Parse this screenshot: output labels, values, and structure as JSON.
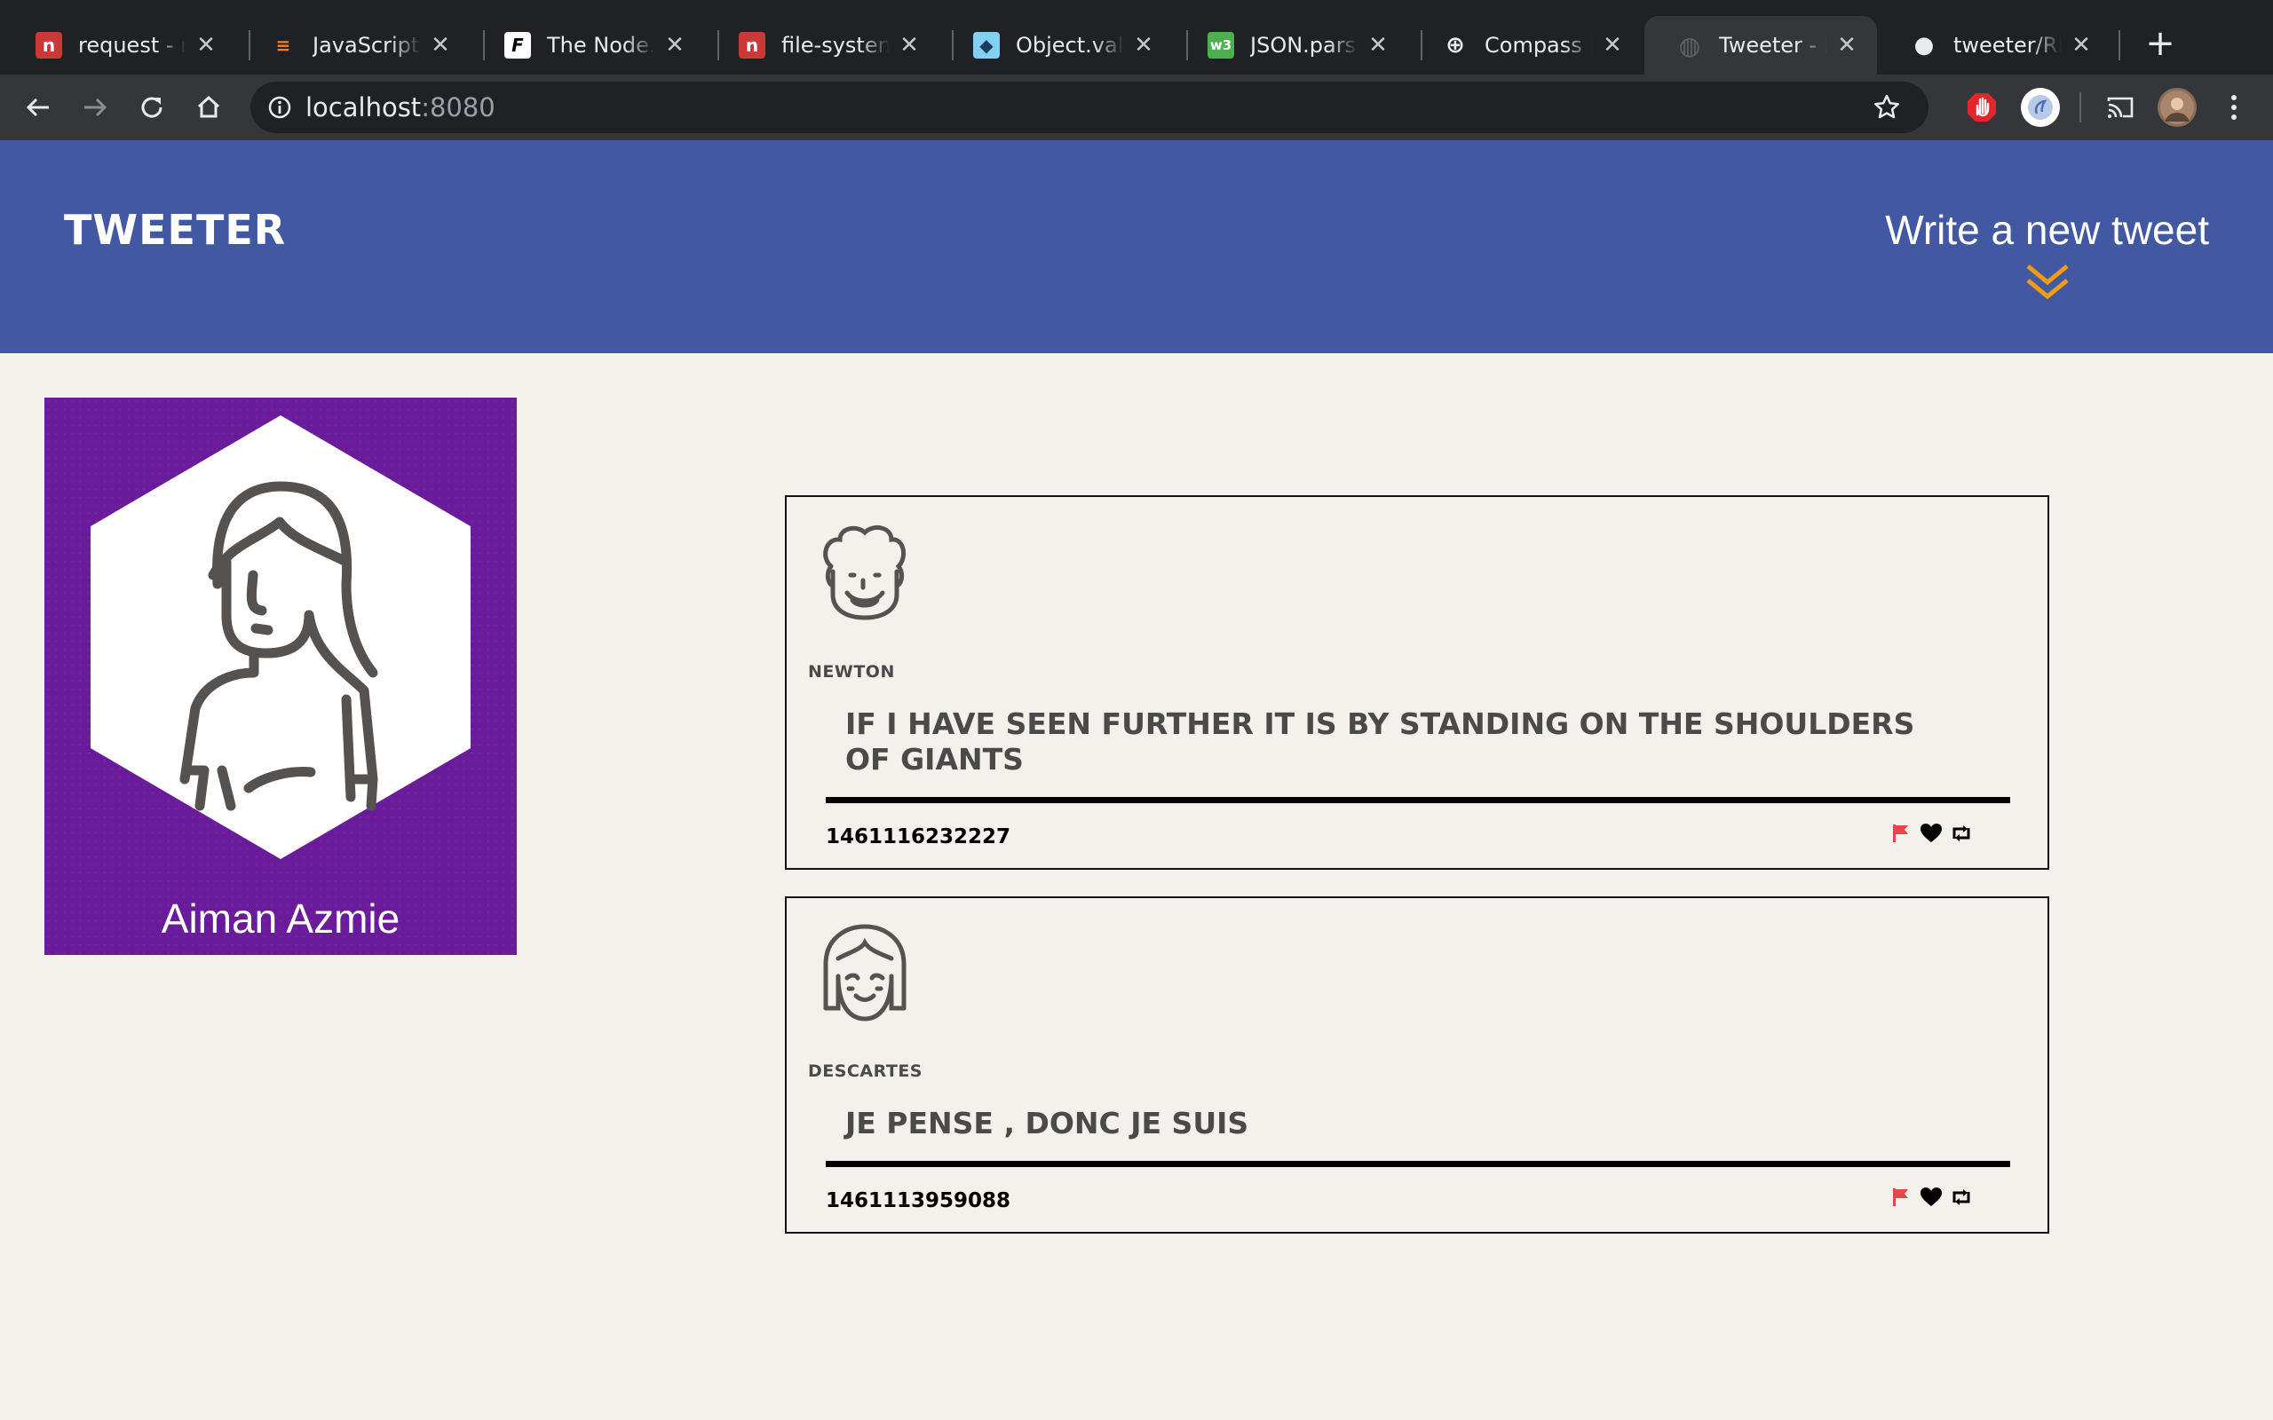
{
  "browser": {
    "tabs": [
      {
        "title": "request - npm",
        "favicon_letter": "n",
        "favicon_color": "#cb3837"
      },
      {
        "title": "JavaScript Closures",
        "favicon_letter": "≡",
        "favicon_color": "#f48024"
      },
      {
        "title": "The Node.js Way",
        "favicon_letter": "F",
        "favicon_color": "#ffffff"
      },
      {
        "title": "file-system - npm",
        "favicon_letter": "n",
        "favicon_color": "#cb3837"
      },
      {
        "title": "Object.values()",
        "favicon_letter": "◆",
        "favicon_color": "#83d0f2"
      },
      {
        "title": "JSON.parse()",
        "favicon_letter": "w3",
        "favicon_color": "#4caf50"
      },
      {
        "title": "Compass | The",
        "favicon_letter": "⊕",
        "favicon_color": "#202124"
      },
      {
        "title": "Tweeter - Home Page",
        "favicon_letter": "◍",
        "favicon_color": "#5f6368"
      },
      {
        "title": "tweeter/README.md",
        "favicon_letter": "●",
        "favicon_color": "#202124"
      }
    ],
    "active_tab": 7,
    "url_host": "localhost",
    "url_port": ":8080"
  },
  "header": {
    "logo": "Tweeter",
    "compose_label": "Write a new tweet",
    "arrow_color": "#f39c12"
  },
  "profile": {
    "name": "Aiman Azmie",
    "background_color": "#6a1b9a"
  },
  "tweets": [
    {
      "handle": "Newton",
      "content": "If I have seen further it is by standing on the shoulders of giants",
      "timestamp": "1461116232227",
      "avatar_icon": "curly-hair-man-avatar-icon"
    },
    {
      "handle": "Descartes",
      "content": "Je pense , donc je suis",
      "timestamp": "1461113959088",
      "avatar_icon": "bob-hair-girl-avatar-icon"
    }
  ],
  "actions": {
    "flag_color": "#e8454b",
    "icons": [
      "flag-icon",
      "heart-icon",
      "retweet-icon"
    ]
  }
}
